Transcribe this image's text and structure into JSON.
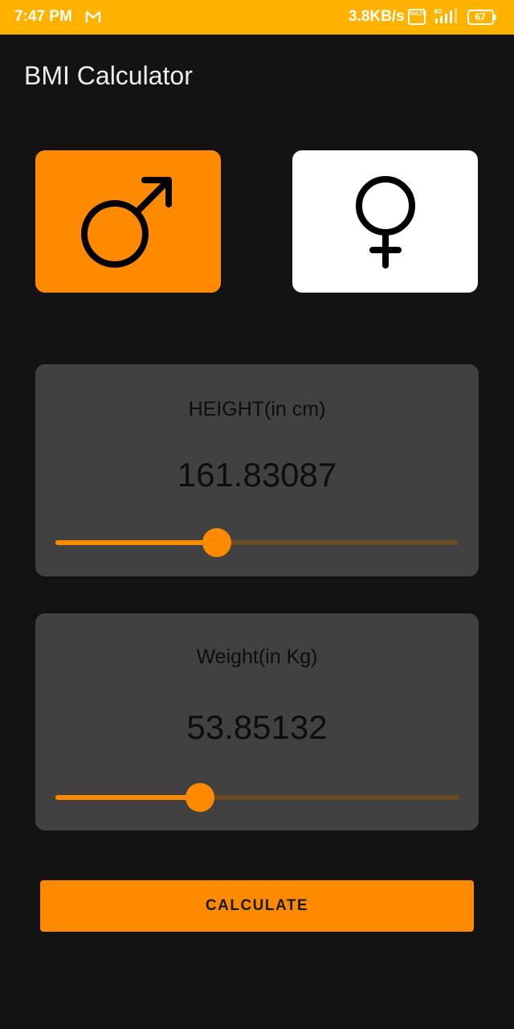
{
  "status_bar": {
    "time": "7:47 PM",
    "net_speed": "3.8KB/s",
    "network_type": "4G",
    "volte_label": "VoLTE",
    "battery_level": "67",
    "color": "#FFB300"
  },
  "app": {
    "title": "BMI Calculator"
  },
  "gender": {
    "male_icon": "male-symbol-icon",
    "female_icon": "female-symbol-icon",
    "selected": "male",
    "selected_color": "#FF8A00",
    "unselected_color": "#FFFFFF"
  },
  "height": {
    "label": "HEIGHT(in cm)",
    "value": "161.83087",
    "slider_fraction": 0.4
  },
  "weight": {
    "label": "Weight(in Kg)",
    "value": "53.85132",
    "slider_fraction": 0.358
  },
  "calculate_button": {
    "label": "CALCULATE"
  },
  "colors": {
    "accent": "#FF8A00",
    "panel": "#414141",
    "background": "#131313"
  }
}
